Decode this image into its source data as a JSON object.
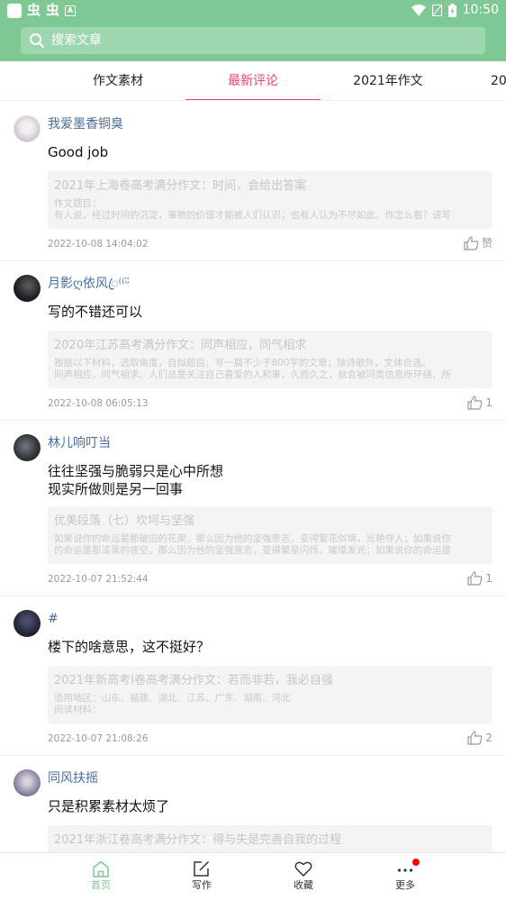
{
  "status_bar": {
    "time": "10:50",
    "a_icon_label": "A"
  },
  "search": {
    "placeholder": "搜索文章"
  },
  "tabs": [
    {
      "label": "作文素材"
    },
    {
      "label": "最新评论",
      "active": true
    },
    {
      "label": "2021年作文"
    },
    {
      "label": "202"
    }
  ],
  "comments": [
    {
      "user": "我爱墨香铜臭",
      "lines": [
        "Good  job"
      ],
      "quote_title": "2021年上海卷高考满分作文：时间，会给出答案",
      "quote_lines": [
        "作文题目：",
        "有人说，经过时间的沉淀，事物的价值才能被人们认识；也有人认为不尽如此。你怎么看？请写"
      ],
      "time": "2022-10-08 14:04:02",
      "likes": "赞"
    },
    {
      "user": "月影ღ依风ꦿ⁽⁽ᵕ̈",
      "lines": [
        "写的不错还可以"
      ],
      "quote_title": "2020年江苏高考满分作文：同声相应，同气相求",
      "quote_lines": [
        "根据以下材料，选取角度，自拟题目，写一篇不少于800字的文章；除诗歌外，文体自选。",
        "同声相应，同气相求。人们总是关注自己喜爱的人和事，久而久之，就会被同类信息所环绕、所"
      ],
      "time": "2022-10-08 06:05:13",
      "likes": "1"
    },
    {
      "user": "林儿响叮当",
      "lines": [
        "往往坚强与脆弱只是心中所想",
        "现实所做则是另一回事"
      ],
      "quote_title": "优美段落（七）坎坷与坚强",
      "quote_lines": [
        "如果说你的命运是那破旧的花架，那么因为他的坚强意志，变得繁花似锦，光艳夺人；如果说你",
        "的命运是那漆黑的夜空，那么因为他的坚强意志，变得繁星闪烁，璀璨发光；如果说你的命运是"
      ],
      "time": "2022-10-07 21:52:44",
      "likes": "1"
    },
    {
      "user": "#",
      "lines": [
        "楼下的啥意思，这不挺好？"
      ],
      "quote_title": "2021年新高考Ⅰ卷高考满分作文：若而非若，我必自强",
      "quote_lines": [
        "适用地区：山东、福建、湖北、江苏、广东、湖南、河北",
        "阅读材料："
      ],
      "time": "2022-10-07 21:08:26",
      "likes": "2"
    },
    {
      "user": "同风扶摇",
      "lines": [
        "只是积累素材太烦了"
      ],
      "quote_title": "2021年浙江卷高考满分作文：得与失是完善自我的过程",
      "quote_lines": [],
      "time": "",
      "likes": ""
    }
  ],
  "bottom_nav": [
    {
      "label": "首页",
      "icon": "home-icon",
      "active": true
    },
    {
      "label": "写作",
      "icon": "edit-icon"
    },
    {
      "label": "收藏",
      "icon": "heart-icon"
    },
    {
      "label": "更多",
      "icon": "more-icon",
      "badge": true
    }
  ],
  "colors": {
    "header": "#7ec893",
    "accent_tab": "#e8437b",
    "username": "#4a6e9c",
    "badge": "#ff0000"
  }
}
